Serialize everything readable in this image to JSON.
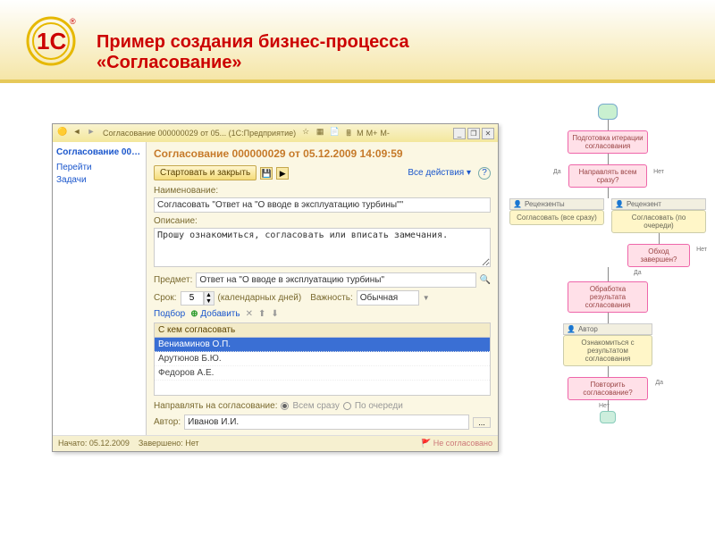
{
  "slide": {
    "title_l1": "Пример создания бизнес-процесса",
    "title_l2": "«Согласование»"
  },
  "logo": {
    "red": "1C",
    "reg": "®"
  },
  "titlebar": {
    "text": "Согласование 000000029 от 05...   (1С:Предприятие)",
    "m": "M",
    "mplus": "M+",
    "mminus": "M-"
  },
  "nav": {
    "heading": "Согласование 000000...",
    "link1": "Перейти",
    "link2": "Задачи"
  },
  "form": {
    "title": "Согласование 000000029 от 05.12.2009 14:09:59",
    "start_btn": "Стартовать и закрыть",
    "all_actions": "Все действия ▾",
    "name_label": "Наименование:",
    "name_value": "Согласовать \"Ответ на \"О вводе в эксплуатацию турбины\"\"",
    "desc_label": "Описание:",
    "desc_value": "Прошу ознакомиться, согласовать или вписать замечания.",
    "subject_label": "Предмет:",
    "subject_value": "Ответ на \"О вводе в эксплуатацию турбины\"",
    "term_label": "Срок:",
    "term_value": "5",
    "term_suffix": "(календарных дней)",
    "importance_label": "Важность:",
    "importance_value": "Обычная",
    "pick": "Подбор",
    "add": "Добавить",
    "table_header": "С кем согласовать",
    "rows": [
      "Вениаминов О.П.",
      "Арутюнов Б.Ю.",
      "Федоров А.Е."
    ],
    "send_label": "Направлять на согласование:",
    "opt_all": "Всем сразу",
    "opt_queue": "По очереди",
    "author_label": "Автор:",
    "author_value": "Иванов И.И.",
    "status_started": "Начато: 05.12.2009",
    "status_done": "Завершено: Нет",
    "status_not": "Не согласовано"
  },
  "flow": {
    "prep": "Подготовка итерации согласования",
    "decide_all": "Направлять всем сразу?",
    "yes": "Да",
    "no": "Нет",
    "role_reviewers": "Рецензенты",
    "box_all": "Согласовать (все сразу)",
    "role_reviewer": "Рецензент",
    "box_queue": "Согласовать (по очереди)",
    "decide_round": "Обход завершен?",
    "process": "Обработка результата согласования",
    "role_author": "Автор",
    "box_author": "Ознакомиться с результатом согласования",
    "decide_repeat": "Повторить согласование?"
  }
}
